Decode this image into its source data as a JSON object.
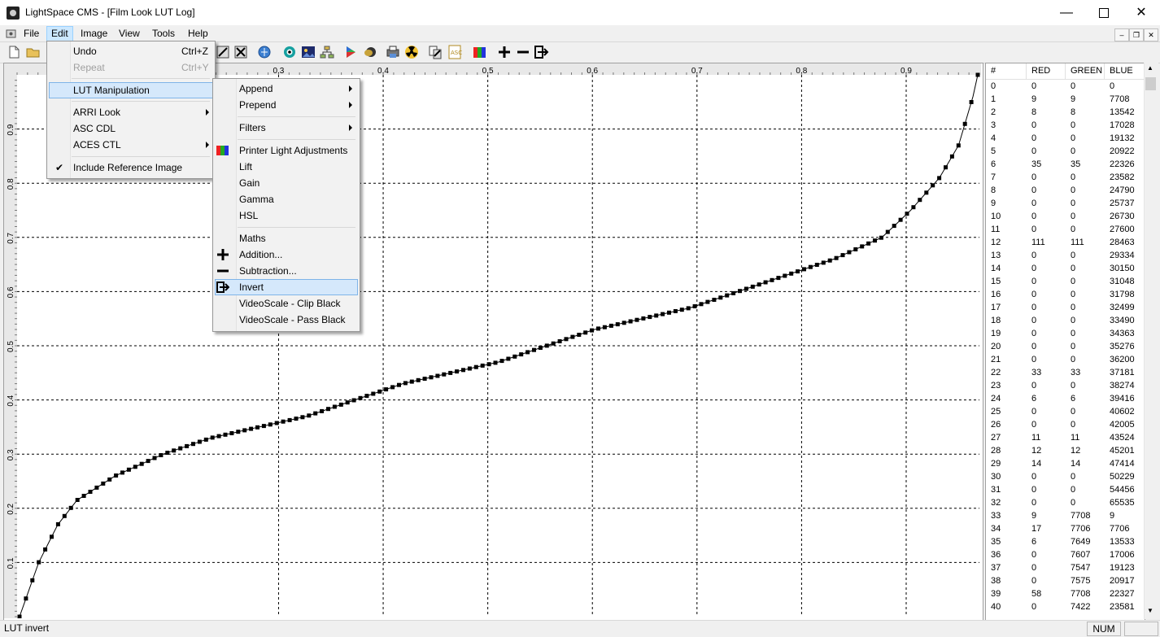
{
  "window": {
    "title": "LightSpace CMS - [Film Look LUT Log]"
  },
  "menubar": {
    "items": [
      "File",
      "Edit",
      "Image",
      "View",
      "Tools",
      "Help"
    ]
  },
  "edit_menu": {
    "undo": {
      "label": "Undo",
      "shortcut": "Ctrl+Z"
    },
    "repeat": {
      "label": "Repeat",
      "shortcut": "Ctrl+Y"
    },
    "lut_manipulation": "LUT Manipulation",
    "arri_look": "ARRI Look",
    "asc_cdl": "ASC CDL",
    "aces_ctl": "ACES CTL",
    "include_reference": "Include Reference Image"
  },
  "lut_submenu": {
    "append": "Append",
    "prepend": "Prepend",
    "filters": "Filters",
    "printer_light": "Printer Light Adjustments",
    "lift": "Lift",
    "gain": "Gain",
    "gamma": "Gamma",
    "hsl": "HSL",
    "maths": "Maths",
    "addition": "Addition...",
    "subtraction": "Subtraction...",
    "invert": "Invert",
    "videoscale_clip": "VideoScale - Clip Black",
    "videoscale_pass": "VideoScale - Pass Black"
  },
  "chart_data": {
    "type": "line",
    "x_ticks": [
      "0.3",
      "0.4",
      "0.5",
      "0.6",
      "0.7",
      "0.8",
      "0.9"
    ],
    "y_ticks": [
      "0.1",
      "0.2",
      "0.3",
      "0.4",
      "0.5",
      "0.6",
      "0.7",
      "0.8",
      "0.9"
    ],
    "xlim": [
      0.05,
      0.97
    ],
    "ylim": [
      0,
      1.0
    ],
    "curve": [
      [
        0.0,
        0.0
      ],
      [
        0.02,
        0.1
      ],
      [
        0.04,
        0.17
      ],
      [
        0.06,
        0.215
      ],
      [
        0.1,
        0.26
      ],
      [
        0.15,
        0.3
      ],
      [
        0.2,
        0.33
      ],
      [
        0.3,
        0.37
      ],
      [
        0.35,
        0.4
      ],
      [
        0.4,
        0.43
      ],
      [
        0.5,
        0.47
      ],
      [
        0.6,
        0.53
      ],
      [
        0.7,
        0.57
      ],
      [
        0.75,
        0.6
      ],
      [
        0.8,
        0.63
      ],
      [
        0.85,
        0.66
      ],
      [
        0.9,
        0.7
      ],
      [
        0.93,
        0.75
      ],
      [
        0.96,
        0.81
      ],
      [
        0.98,
        0.87
      ],
      [
        0.995,
        0.96
      ],
      [
        1.0,
        1.0
      ]
    ],
    "grid": true
  },
  "table": {
    "headers": [
      "#",
      "RED",
      "GREEN",
      "BLUE"
    ],
    "rows": [
      [
        "0",
        "0",
        "0",
        "0"
      ],
      [
        "1",
        "9",
        "9",
        "7708"
      ],
      [
        "2",
        "8",
        "8",
        "13542"
      ],
      [
        "3",
        "0",
        "0",
        "17028"
      ],
      [
        "4",
        "0",
        "0",
        "19132"
      ],
      [
        "5",
        "0",
        "0",
        "20922"
      ],
      [
        "6",
        "35",
        "35",
        "22326"
      ],
      [
        "7",
        "0",
        "0",
        "23582"
      ],
      [
        "8",
        "0",
        "0",
        "24790"
      ],
      [
        "9",
        "0",
        "0",
        "25737"
      ],
      [
        "10",
        "0",
        "0",
        "26730"
      ],
      [
        "11",
        "0",
        "0",
        "27600"
      ],
      [
        "12",
        "111",
        "111",
        "28463"
      ],
      [
        "13",
        "0",
        "0",
        "29334"
      ],
      [
        "14",
        "0",
        "0",
        "30150"
      ],
      [
        "15",
        "0",
        "0",
        "31048"
      ],
      [
        "16",
        "0",
        "0",
        "31798"
      ],
      [
        "17",
        "0",
        "0",
        "32499"
      ],
      [
        "18",
        "0",
        "0",
        "33490"
      ],
      [
        "19",
        "0",
        "0",
        "34363"
      ],
      [
        "20",
        "0",
        "0",
        "35276"
      ],
      [
        "21",
        "0",
        "0",
        "36200"
      ],
      [
        "22",
        "33",
        "33",
        "37181"
      ],
      [
        "23",
        "0",
        "0",
        "38274"
      ],
      [
        "24",
        "6",
        "6",
        "39416"
      ],
      [
        "25",
        "0",
        "0",
        "40602"
      ],
      [
        "26",
        "0",
        "0",
        "42005"
      ],
      [
        "27",
        "11",
        "11",
        "43524"
      ],
      [
        "28",
        "12",
        "12",
        "45201"
      ],
      [
        "29",
        "14",
        "14",
        "47414"
      ],
      [
        "30",
        "0",
        "0",
        "50229"
      ],
      [
        "31",
        "0",
        "0",
        "54456"
      ],
      [
        "32",
        "0",
        "0",
        "65535"
      ],
      [
        "33",
        "9",
        "7708",
        "9"
      ],
      [
        "34",
        "17",
        "7706",
        "7706"
      ],
      [
        "35",
        "6",
        "7649",
        "13533"
      ],
      [
        "36",
        "0",
        "7607",
        "17006"
      ],
      [
        "37",
        "0",
        "7547",
        "19123"
      ],
      [
        "38",
        "0",
        "7575",
        "20917"
      ],
      [
        "39",
        "58",
        "7708",
        "22327"
      ],
      [
        "40",
        "0",
        "7422",
        "23581"
      ]
    ]
  },
  "statusbar": {
    "text": "LUT invert",
    "num": "NUM"
  },
  "icons": [
    "app-icon",
    "new-file-icon",
    "open-folder-icon",
    "lut-tool-icon",
    "close-lut-icon",
    "globe-icon",
    "target-icon",
    "image-icon",
    "network-icon",
    "play-icon",
    "mask-icon",
    "printer-icon",
    "radiation-icon",
    "copy-icon",
    "asc-icon",
    "rgb-bars-icon",
    "plus-icon",
    "minus-icon",
    "invert-icon"
  ]
}
